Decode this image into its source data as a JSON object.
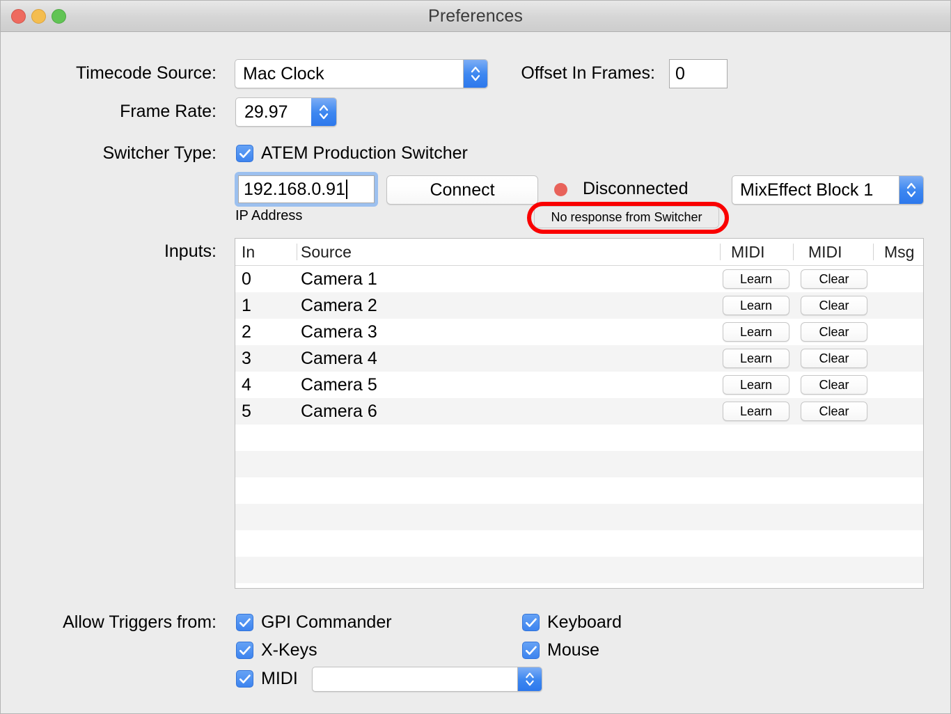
{
  "window": {
    "title": "Preferences",
    "traffic_lights": [
      {
        "name": "close",
        "color": "#ee6a5f"
      },
      {
        "name": "minimize",
        "color": "#f4bd4f"
      },
      {
        "name": "maximize",
        "color": "#61c454"
      }
    ]
  },
  "form": {
    "timecode_source_label": "Timecode Source:",
    "timecode_source_value": "Mac Clock",
    "offset_label": "Offset In Frames:",
    "offset_value": "0",
    "frame_rate_label": "Frame Rate:",
    "frame_rate_value": "29.97",
    "switcher_type_label": "Switcher Type:",
    "switcher_type_checkbox_label": "ATEM Production Switcher",
    "switcher_type_checked": true,
    "ip_value": "192.168.0.91",
    "ip_caption": "IP Address",
    "connect_label": "Connect",
    "status_label": "Disconnected",
    "status_color": "#e8625a",
    "mixeffect_value": "MixEffect Block 1",
    "tooltip_text": "No response from Switcher",
    "annotation_color": "#fa0000",
    "inputs_label": "Inputs:"
  },
  "table": {
    "columns": [
      "In",
      "Source",
      "MIDI",
      "MIDI",
      "Msg"
    ],
    "rows": [
      {
        "in": "0",
        "source": "Camera 1",
        "learn": "Learn",
        "clear": "Clear"
      },
      {
        "in": "1",
        "source": "Camera 2",
        "learn": "Learn",
        "clear": "Clear"
      },
      {
        "in": "2",
        "source": "Camera 3",
        "learn": "Learn",
        "clear": "Clear"
      },
      {
        "in": "3",
        "source": "Camera 4",
        "learn": "Learn",
        "clear": "Clear"
      },
      {
        "in": "4",
        "source": "Camera 5",
        "learn": "Learn",
        "clear": "Clear"
      },
      {
        "in": "5",
        "source": "Camera 6",
        "learn": "Learn",
        "clear": "Clear"
      }
    ],
    "empty_row_count": 6
  },
  "triggers": {
    "label": "Allow Triggers from:",
    "gpi_commander": {
      "label": "GPI Commander",
      "checked": true
    },
    "x_keys": {
      "label": "X-Keys",
      "checked": true
    },
    "midi": {
      "label": "MIDI",
      "checked": true,
      "selected_value": ""
    },
    "keyboard": {
      "label": "Keyboard",
      "checked": true
    },
    "mouse": {
      "label": "Mouse",
      "checked": true
    }
  }
}
